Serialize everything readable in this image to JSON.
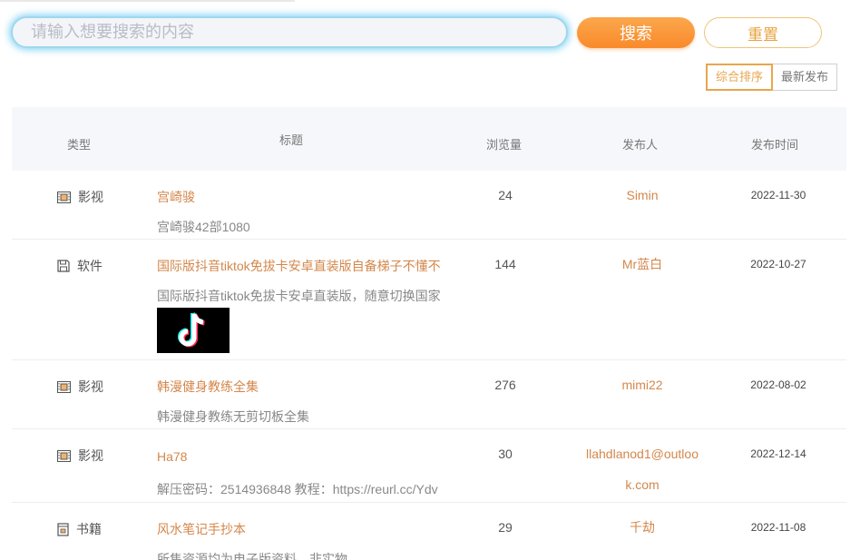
{
  "search": {
    "placeholder": "请输入想要搜索的内容",
    "value": "",
    "search_label": "搜索",
    "reset_label": "重置"
  },
  "sort": {
    "options": [
      "综合排序",
      "最新发布"
    ],
    "active": "综合排序"
  },
  "table": {
    "headers": {
      "type": "类型",
      "title": "标题",
      "views": "浏览量",
      "publisher": "发布人",
      "time": "发布时间"
    },
    "rows": [
      {
        "type": "影视",
        "type_icon": "film-icon",
        "title": "宫崎骏",
        "desc": "宫崎骏42部1080",
        "views": "24",
        "publisher": "Simin",
        "time": "2022-11-30"
      },
      {
        "type": "软件",
        "type_icon": "save-icon",
        "title": "国际版抖音tiktok免拔卡安卓直装版自备梯子不懂不要拍",
        "desc": "国际版抖音tiktok免拔卡安卓直装版，随意切换国家地区",
        "views": "144",
        "publisher": "Mr蓝白",
        "time": "2022-10-27",
        "thumbnail_icon": "tiktok-logo-icon"
      },
      {
        "type": "影视",
        "type_icon": "film-icon",
        "title": "韩漫健身教练全集",
        "desc": "韩漫健身教练无剪切板全集",
        "views": "276",
        "publisher": "mimi22",
        "time": "2022-08-02"
      },
      {
        "type": "影视",
        "type_icon": "film-icon",
        "title": "Ha78",
        "desc": "解压密码：2514936848 教程：https://reurl.cc/Ydv",
        "views": "30",
        "publisher": "llahdlanod1@outlook.com",
        "time": "2022-12-14"
      },
      {
        "type": "书籍",
        "type_icon": "book-icon",
        "title": "风水笔记手抄本",
        "desc": "所售资源均为电子版资料，非实物",
        "views": "29",
        "publisher": "千劫",
        "time": "2022-11-08"
      }
    ]
  },
  "colors": {
    "accent_orange": "#f98a2a",
    "link_orange": "#d4874b",
    "glow_blue": "#60c8f0"
  }
}
